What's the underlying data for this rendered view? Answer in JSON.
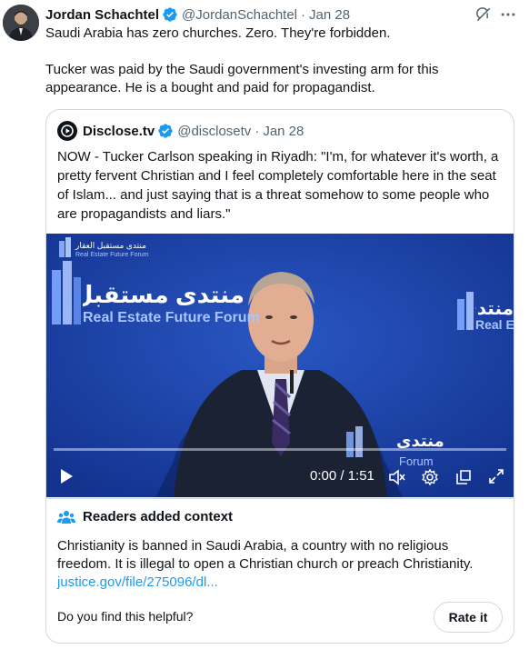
{
  "tweet": {
    "author_name": "Jordan Schachtel",
    "author_handle": "@JordanSchachtel",
    "separator": "·",
    "date": "Jan 28",
    "paragraphs": [
      "Saudi Arabia has zero churches. Zero. They're forbidden.",
      "Tucker was paid by the Saudi government's investing arm for this appearance. He is a bought and paid for propagandist."
    ]
  },
  "quoted_tweet": {
    "author_name": "Disclose.tv",
    "author_handle": "@disclosetv",
    "separator": "·",
    "date": "Jan 28",
    "text": "NOW - Tucker Carlson speaking in Riyadh: \"I'm, for whatever it's worth, a pretty fervent Christian and I feel completely comfortable here in the seat of Islam... and  just saying that is a threat somehow to some people who are propagandists and liars.\""
  },
  "video": {
    "banner_arabic": "منتدى مستقبل العقار",
    "banner_english": "Real Estate Future Forum",
    "logo_arabic_small": "منتدى مستقبل العقار",
    "logo_english_small": "Real Estate Future Forum",
    "right_arabic": "منتدى العقار",
    "right_english": "Real Estate",
    "lower_arabic": "منتدى",
    "lower_english": "Forum",
    "time": "0:00 / 1:51",
    "progress": 0
  },
  "community_note": {
    "title": "Readers added context",
    "body": "Christianity is banned in Saudi Arabia, a country with no religious freedom. It is illegal to open a Christian church or preach Christianity.",
    "link": "justice.gov/file/275096/dl...",
    "question": "Do you find this helpful?",
    "rate_label": "Rate it"
  },
  "colors": {
    "verified": "#1d9bf0",
    "link": "#1d9bf0",
    "muted": "#536471",
    "border": "#cfd9de"
  }
}
